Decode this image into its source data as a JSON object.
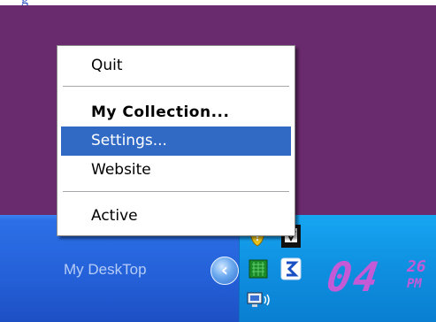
{
  "menu": {
    "items": [
      {
        "label": "Quit"
      },
      {
        "label": "My Collection..."
      },
      {
        "label": "Settings..."
      },
      {
        "label": "Website"
      },
      {
        "label": "Active"
      }
    ]
  },
  "taskbar": {
    "label": "My DeskTop"
  },
  "tray": {
    "chevron_glyph": "‹",
    "icons": [
      "shield-icon",
      "notepad-icon",
      "app-icon",
      "green-square-icon",
      "blue-arrow-icon",
      "network-icon"
    ]
  },
  "clock": {
    "hour": "04",
    "minute": "26",
    "ampm": "PM"
  },
  "colors": {
    "desktop": "#6a2a6e",
    "menu_highlight": "#316ac5",
    "clock_digits": "#c45ad6"
  }
}
